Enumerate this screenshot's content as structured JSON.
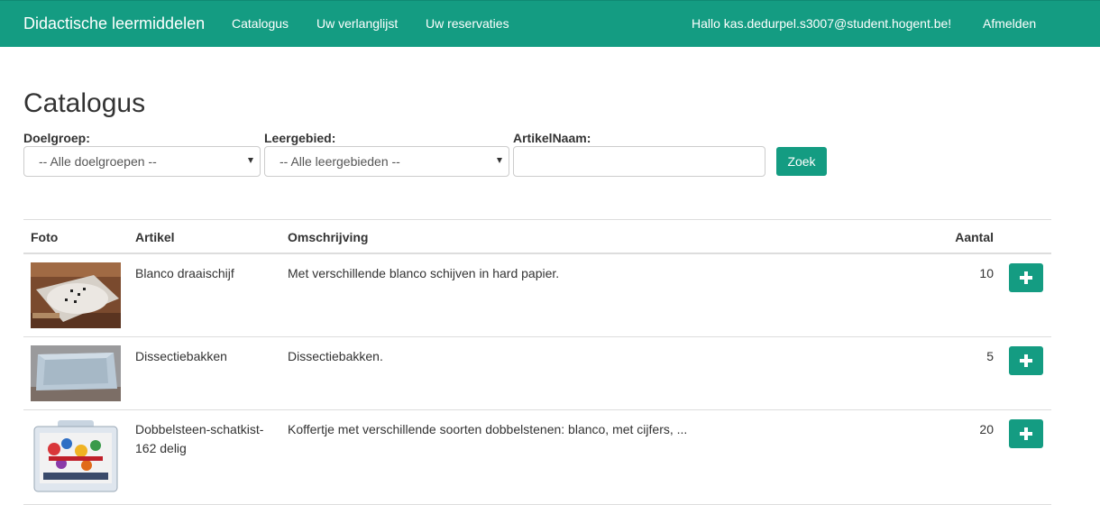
{
  "navbar": {
    "brand": "Didactische leermiddelen",
    "links": [
      "Catalogus",
      "Uw verlanglijst",
      "Uw reservaties"
    ],
    "greeting": "Hallo kas.dedurpel.s3007@student.hogent.be!",
    "logout": "Afmelden",
    "color": "#149c82"
  },
  "page": {
    "title": "Catalogus"
  },
  "filters": {
    "doelgroep_label": "Doelgroep:",
    "doelgroep_value": "-- Alle doelgroepen --",
    "leergebied_label": "Leergebied:",
    "leergebied_value": "-- Alle leergebieden --",
    "artikelnaam_label": "ArtikelNaam:",
    "artikelnaam_value": "",
    "search_label": "Zoek"
  },
  "table": {
    "columns": [
      "Foto",
      "Artikel",
      "Omschrijving",
      "Aantal"
    ],
    "rows": [
      {
        "artikel": "Blanco draaischijf",
        "omschrijving": "Met verschillende blanco schijven in hard papier.",
        "aantal": "10",
        "photo": "turntable-photo"
      },
      {
        "artikel": "Dissectiebakken",
        "omschrijving": "Dissectiebakken.",
        "aantal": "5",
        "photo": "tray-photo"
      },
      {
        "artikel": "Dobbelsteen-schatkist-162 delig",
        "omschrijving": "Koffertje met verschillende soorten dobbelstenen: blanco, met cijfers, ...",
        "aantal": "20",
        "photo": "dice-case-photo"
      }
    ],
    "add_icon": "plus-icon"
  }
}
